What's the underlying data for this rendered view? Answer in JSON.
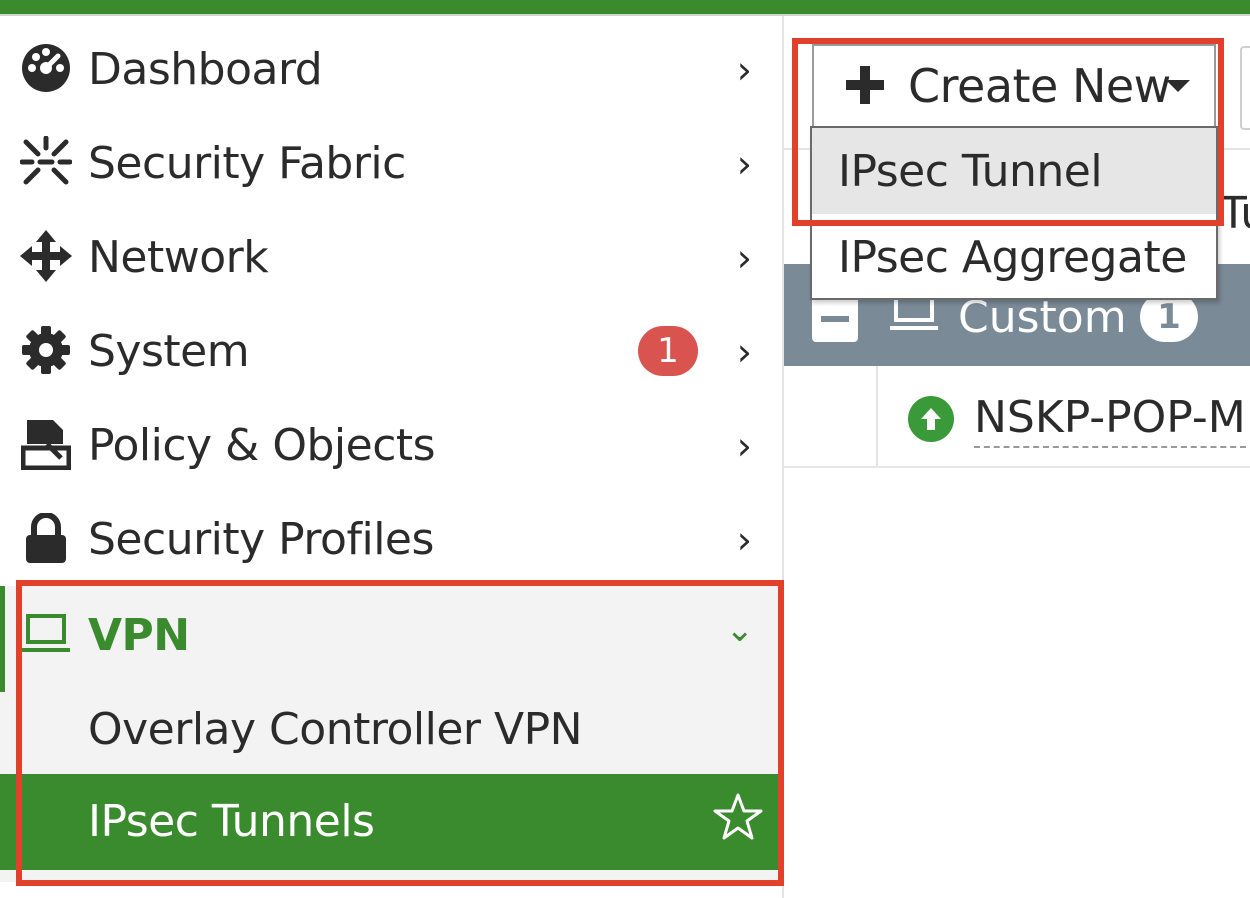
{
  "sidebar": {
    "items": [
      {
        "label": "Dashboard",
        "icon": "dashboard-icon"
      },
      {
        "label": "Security Fabric",
        "icon": "security-fabric-icon"
      },
      {
        "label": "Network",
        "icon": "network-icon"
      },
      {
        "label": "System",
        "icon": "gear-icon",
        "badge": "1"
      },
      {
        "label": "Policy & Objects",
        "icon": "policy-icon"
      },
      {
        "label": "Security Profiles",
        "icon": "lock-icon"
      },
      {
        "label": "VPN",
        "icon": "laptop-icon",
        "expanded": true
      }
    ],
    "vpn_children": [
      {
        "label": "Overlay Controller VPN"
      },
      {
        "label": "IPsec Tunnels",
        "active": true
      }
    ]
  },
  "toolbar": {
    "create_new_label": "Create New",
    "dropdown_items": [
      "IPsec Tunnel",
      "IPsec Aggregate"
    ]
  },
  "table": {
    "column_hint": "Tu",
    "group": {
      "label": "Custom",
      "count": "1"
    },
    "rows": [
      {
        "name": "NSKP-POP-M",
        "status": "up"
      }
    ]
  },
  "colors": {
    "accent": "#3a8a2e",
    "highlight_box": "#e2402a",
    "badge": "#d9534f",
    "group_row": "#7a8a96"
  }
}
